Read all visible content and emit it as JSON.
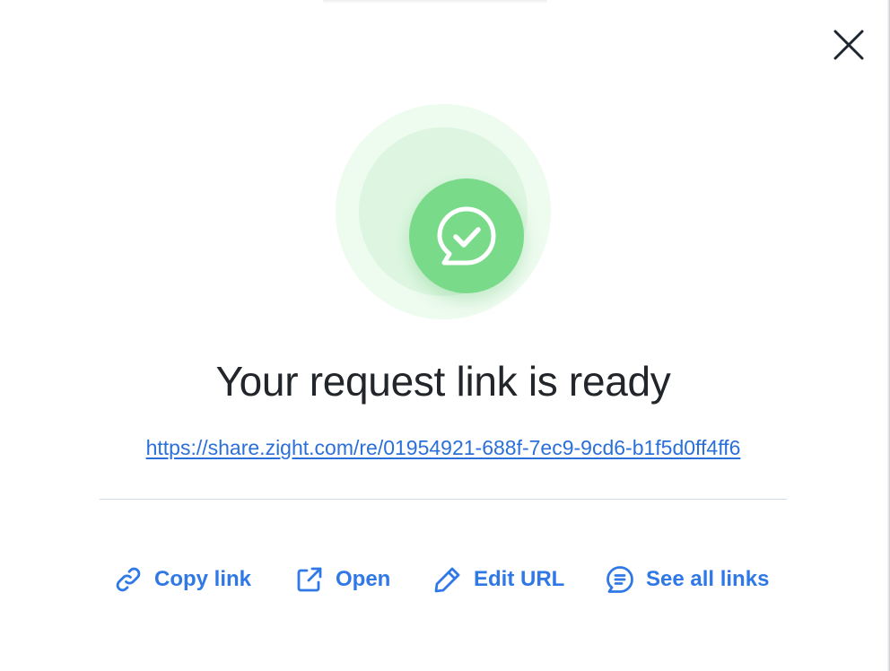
{
  "dialog": {
    "title": "Your request link is ready",
    "link": "https://share.zight.com/re/01954921-688f-7ec9-9cd6-b1f5d0ff4ff6",
    "close_icon": "close-icon",
    "hero_icon": "chat-check-icon"
  },
  "actions": [
    {
      "label": "Copy link",
      "icon": "link-icon"
    },
    {
      "label": "Open",
      "icon": "external-link-icon"
    },
    {
      "label": "Edit URL",
      "icon": "pencil-icon"
    },
    {
      "label": "See all links",
      "icon": "chat-list-icon"
    }
  ],
  "colors": {
    "accent": "#2f78e6",
    "link": "#2b6fd8",
    "success": "#79da89",
    "title": "#22262a"
  }
}
